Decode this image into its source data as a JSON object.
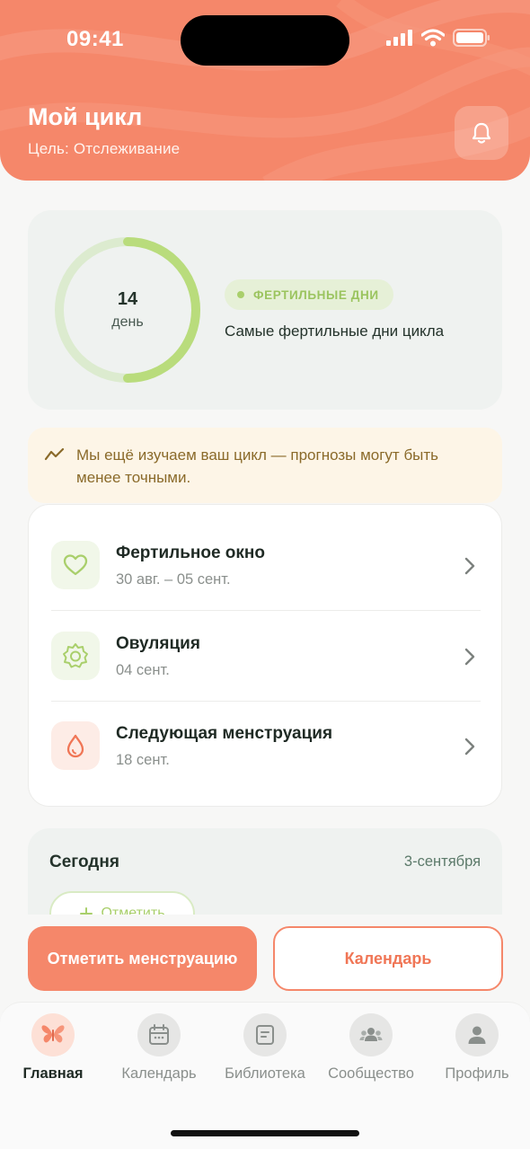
{
  "status_bar": {
    "time": "09:41"
  },
  "header": {
    "title": "Мой цикл",
    "subtitle": "Цель: Отслеживание",
    "bell_icon": "bell-icon",
    "background": "#f5876a"
  },
  "cycle": {
    "day_number": "14",
    "day_label": "день",
    "progress": 0.5,
    "phase_label": "ФЕРТИЛЬНЫЕ ДНИ",
    "phase_description": "Самые фертильные дни цикла",
    "phase_color": "#a9cf6b"
  },
  "banner": {
    "icon": "trend-icon",
    "text": "Мы ещё изучаем ваш цикл — прогнозы могут быть менее точными."
  },
  "predictions": [
    {
      "icon": "heart-icon",
      "title": "Фертильное окно",
      "subtitle": "30 авг. – 05 сент."
    },
    {
      "icon": "sun-icon",
      "title": "Овуляция",
      "subtitle": "04 сент."
    },
    {
      "icon": "drop-icon",
      "title": "Следующая менструация",
      "subtitle": "18 сент."
    }
  ],
  "today": {
    "title": "Сегодня",
    "date": "3-сентября",
    "mark_label": "Отметить"
  },
  "actions": {
    "primary": "Отметить менструацию",
    "secondary": "Календарь"
  },
  "nav": [
    {
      "icon": "butterfly-icon",
      "label": "Главная",
      "active": true
    },
    {
      "icon": "calendar-icon",
      "label": "Календарь",
      "active": false
    },
    {
      "icon": "library-icon",
      "label": "Библиотека",
      "active": false
    },
    {
      "icon": "community-icon",
      "label": "Сообщество",
      "active": false
    },
    {
      "icon": "profile-icon",
      "label": "Профиль",
      "active": false
    }
  ],
  "colors": {
    "accent": "#f5876a",
    "fertile": "#a9cf6b",
    "menstruation": "#f07656"
  }
}
